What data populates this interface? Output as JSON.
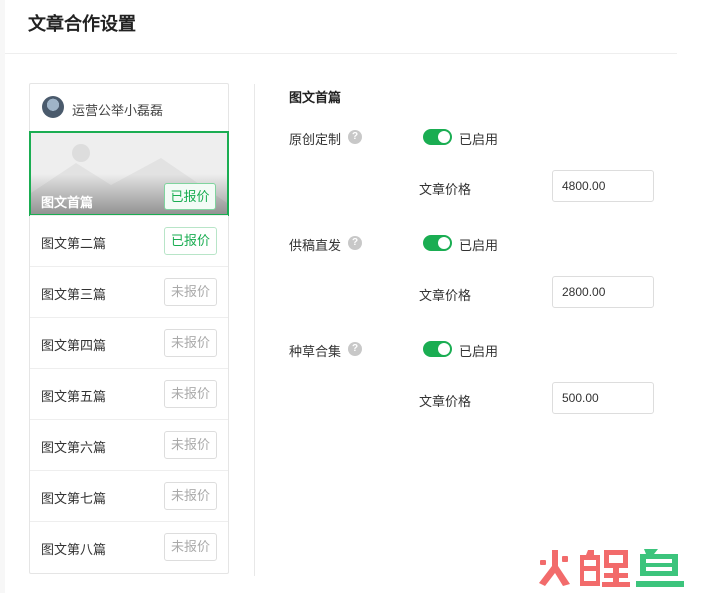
{
  "page": {
    "title": "文章合作设置"
  },
  "account": {
    "name": "运营公举小磊磊"
  },
  "articles": [
    {
      "title": "图文首篇",
      "status": "已报价",
      "quoted": true
    },
    {
      "title": "图文第二篇",
      "status": "已报价",
      "quoted": true
    },
    {
      "title": "图文第三篇",
      "status": "未报价",
      "quoted": false
    },
    {
      "title": "图文第四篇",
      "status": "未报价",
      "quoted": false
    },
    {
      "title": "图文第五篇",
      "status": "未报价",
      "quoted": false
    },
    {
      "title": "图文第六篇",
      "status": "未报价",
      "quoted": false
    },
    {
      "title": "图文第七篇",
      "status": "未报价",
      "quoted": false
    },
    {
      "title": "图文第八篇",
      "status": "未报价",
      "quoted": false
    }
  ],
  "settings": {
    "section_title": "图文首篇",
    "help_glyph": "?",
    "price_label": "文章价格",
    "rows": [
      {
        "label": "原创定制",
        "toggle_text": "已启用",
        "enabled": true,
        "price": "4800.00"
      },
      {
        "label": "供稿直发",
        "toggle_text": "已启用",
        "enabled": true,
        "price": "2800.00"
      },
      {
        "label": "种草合集",
        "toggle_text": "已启用",
        "enabled": true,
        "price": "500.00"
      }
    ]
  },
  "watermark": {
    "text": "火鲤鱼"
  },
  "colors": {
    "accent": "#1aad52",
    "border": "#e5e5e5",
    "muted": "#aaaaaa",
    "watermark_red": "#f26b6b",
    "watermark_green": "#3cc47c"
  }
}
